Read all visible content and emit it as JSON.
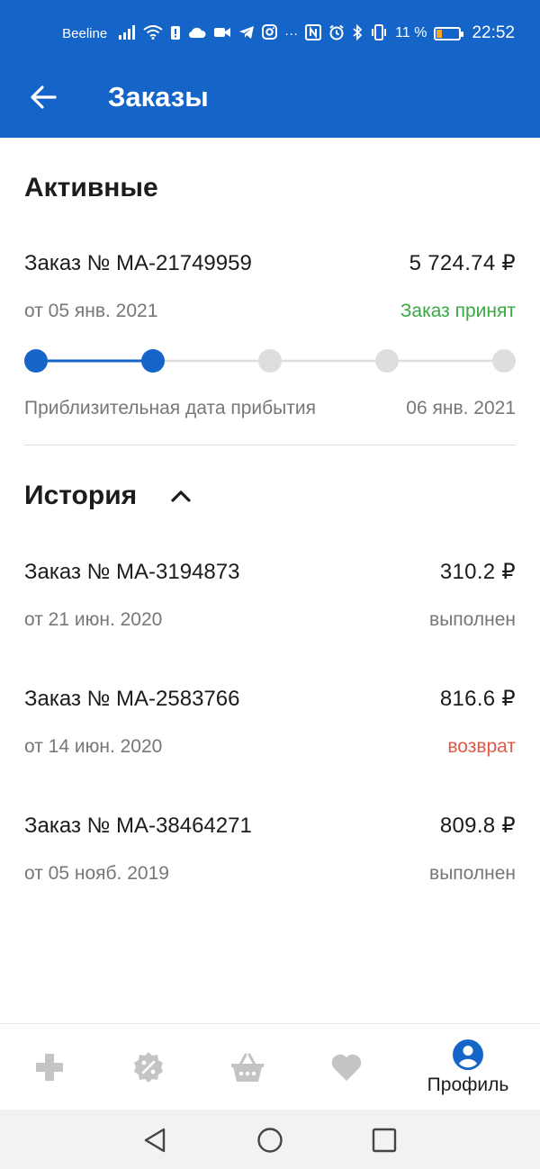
{
  "status_bar": {
    "carrier": "Beeline",
    "more": "···",
    "battery_text": "11 %",
    "battery_level": 0.11,
    "time": "22:52"
  },
  "app_bar": {
    "title": "Заказы",
    "back_icon": "arrow-left-icon"
  },
  "active": {
    "title": "Активные",
    "order": {
      "number": "Заказ № МА-21749959",
      "price": "5 724.74 ₽",
      "date": "от 05 янв. 2021",
      "status": "Заказ принят",
      "progress_steps_total": 5,
      "progress_steps_done": 2,
      "arrival_label": "Приблизительная дата прибытия",
      "arrival_date": "06 янв. 2021"
    }
  },
  "history": {
    "title": "История",
    "toggle_icon": "chevron-up-icon",
    "orders": [
      {
        "number": "Заказ № МА-3194873",
        "price": "310.2 ₽",
        "date": "от 21 июн. 2020",
        "status": "выполнен"
      },
      {
        "number": "Заказ № МА-2583766",
        "price": "816.6 ₽",
        "date": "от 14 июн. 2020",
        "status": "возврат"
      },
      {
        "number": "Заказ № МА-38464271",
        "price": "809.8 ₽",
        "date": "от 05 нояб. 2019",
        "status": "выполнен"
      }
    ]
  },
  "bottom_nav": {
    "items": [
      {
        "icon": "pharmacy-cross-icon"
      },
      {
        "icon": "discount-badge-icon"
      },
      {
        "icon": "basket-icon"
      },
      {
        "icon": "heart-icon"
      },
      {
        "icon": "profile-icon",
        "label": "Профиль",
        "active": true
      }
    ]
  },
  "system_nav": {
    "back": "back-triangle-icon",
    "home": "home-circle-icon",
    "recents": "recents-square-icon"
  },
  "colors": {
    "primary": "#1565c8",
    "success": "#3aa843",
    "danger": "#e05a4a",
    "inactive_icon": "#c4c4c4",
    "progress_inactive": "#dedede"
  }
}
